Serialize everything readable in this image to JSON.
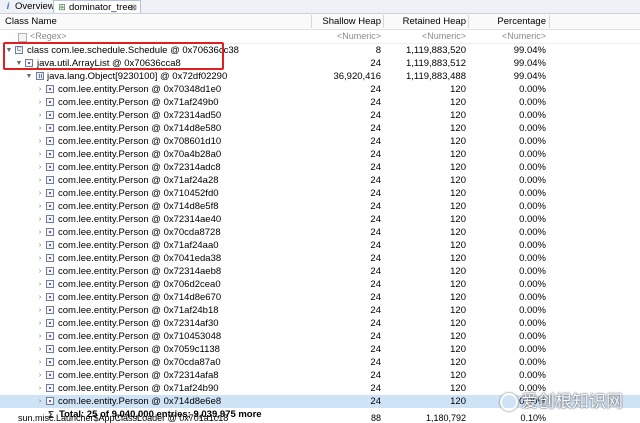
{
  "tabs": {
    "overview": {
      "label": "Overview",
      "icon": "info-icon"
    },
    "dominator": {
      "label": "dominator_tree",
      "icon": "tree-icon",
      "close": "⊠"
    }
  },
  "columns": {
    "class_name": "Class Name",
    "shallow": "Shallow Heap",
    "retained": "Retained Heap",
    "percentage": "Percentage"
  },
  "filters": {
    "class_name": "<Regex>",
    "shallow": "<Numeric>",
    "retained": "<Numeric>",
    "percentage": "<Numeric>"
  },
  "rows": [
    {
      "name": "class com.lee.schedule.Schedule @ 0x70636cc38",
      "shallow": "8",
      "retained": "1,119,883,520",
      "pct": "99.04%"
    },
    {
      "name": "java.util.ArrayList @ 0x70636cca8",
      "shallow": "24",
      "retained": "1,119,883,512",
      "pct": "99.04%"
    },
    {
      "name": "java.lang.Object[9230100] @ 0x72df02290",
      "shallow": "36,920,416",
      "retained": "1,119,883,488",
      "pct": "99.04%"
    },
    {
      "name": "com.lee.entity.Person @ 0x70348d1e0",
      "shallow": "24",
      "retained": "120",
      "pct": "0.00%"
    },
    {
      "name": "com.lee.entity.Person @ 0x71af249b0",
      "shallow": "24",
      "retained": "120",
      "pct": "0.00%"
    },
    {
      "name": "com.lee.entity.Person @ 0x72314ad50",
      "shallow": "24",
      "retained": "120",
      "pct": "0.00%"
    },
    {
      "name": "com.lee.entity.Person @ 0x714d8e580",
      "shallow": "24",
      "retained": "120",
      "pct": "0.00%"
    },
    {
      "name": "com.lee.entity.Person @ 0x708601d10",
      "shallow": "24",
      "retained": "120",
      "pct": "0.00%"
    },
    {
      "name": "com.lee.entity.Person @ 0x70a4b28a0",
      "shallow": "24",
      "retained": "120",
      "pct": "0.00%"
    },
    {
      "name": "com.lee.entity.Person @ 0x72314adc8",
      "shallow": "24",
      "retained": "120",
      "pct": "0.00%"
    },
    {
      "name": "com.lee.entity.Person @ 0x71af24a28",
      "shallow": "24",
      "retained": "120",
      "pct": "0.00%"
    },
    {
      "name": "com.lee.entity.Person @ 0x710452fd0",
      "shallow": "24",
      "retained": "120",
      "pct": "0.00%"
    },
    {
      "name": "com.lee.entity.Person @ 0x714d8e5f8",
      "shallow": "24",
      "retained": "120",
      "pct": "0.00%"
    },
    {
      "name": "com.lee.entity.Person @ 0x72314ae40",
      "shallow": "24",
      "retained": "120",
      "pct": "0.00%"
    },
    {
      "name": "com.lee.entity.Person @ 0x70cda8728",
      "shallow": "24",
      "retained": "120",
      "pct": "0.00%"
    },
    {
      "name": "com.lee.entity.Person @ 0x71af24aa0",
      "shallow": "24",
      "retained": "120",
      "pct": "0.00%"
    },
    {
      "name": "com.lee.entity.Person @ 0x7041eda38",
      "shallow": "24",
      "retained": "120",
      "pct": "0.00%"
    },
    {
      "name": "com.lee.entity.Person @ 0x72314aeb8",
      "shallow": "24",
      "retained": "120",
      "pct": "0.00%"
    },
    {
      "name": "com.lee.entity.Person @ 0x706d2cea0",
      "shallow": "24",
      "retained": "120",
      "pct": "0.00%"
    },
    {
      "name": "com.lee.entity.Person @ 0x714d8e670",
      "shallow": "24",
      "retained": "120",
      "pct": "0.00%"
    },
    {
      "name": "com.lee.entity.Person @ 0x71af24b18",
      "shallow": "24",
      "retained": "120",
      "pct": "0.00%"
    },
    {
      "name": "com.lee.entity.Person @ 0x72314af30",
      "shallow": "24",
      "retained": "120",
      "pct": "0.00%"
    },
    {
      "name": "com.lee.entity.Person @ 0x710453048",
      "shallow": "24",
      "retained": "120",
      "pct": "0.00%"
    },
    {
      "name": "com.lee.entity.Person @ 0x7059c1138",
      "shallow": "24",
      "retained": "120",
      "pct": "0.00%"
    },
    {
      "name": "com.lee.entity.Person @ 0x70cda87a0",
      "shallow": "24",
      "retained": "120",
      "pct": "0.00%"
    },
    {
      "name": "com.lee.entity.Person @ 0x72314afa8",
      "shallow": "24",
      "retained": "120",
      "pct": "0.00%"
    },
    {
      "name": "com.lee.entity.Person @ 0x71af24b90",
      "shallow": "24",
      "retained": "120",
      "pct": "0.00%"
    },
    {
      "name": "com.lee.entity.Person @ 0x714d8e6e8",
      "shallow": "24",
      "retained": "120",
      "pct": "0.00%"
    }
  ],
  "summary": {
    "icon": "sum-icon",
    "label": "Total: 25 of 9,040,000 entries; 9,039,975 more"
  },
  "partial_row": {
    "name": "sun.misc.Launcher$AppClassLoader @ 0x701a1c18",
    "shallow": "88",
    "retained": "1,180,792",
    "pct": "0.10%"
  },
  "watermark": {
    "text": "爱创根知识网"
  },
  "colors": {
    "selection": "#cfe3f7",
    "highlight_box": "#e02020"
  }
}
